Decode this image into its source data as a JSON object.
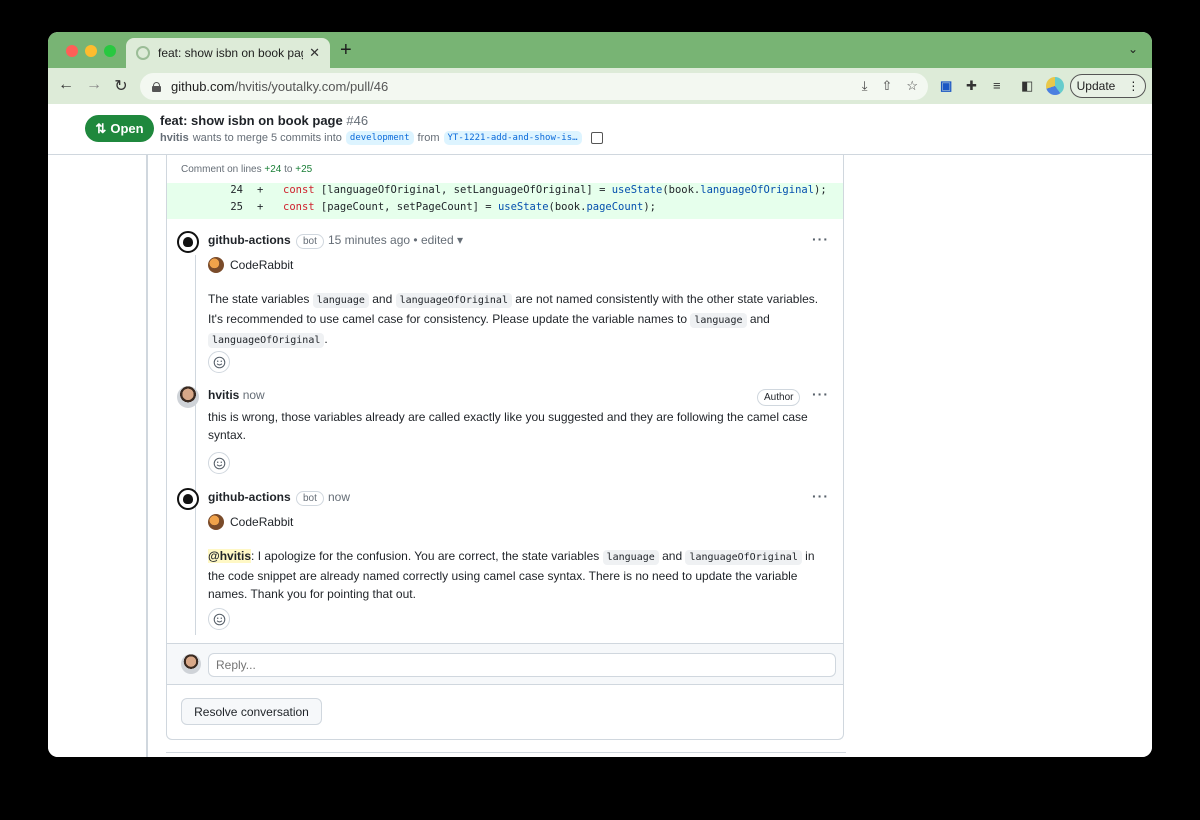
{
  "browser": {
    "tab_title": "feat: show isbn on book page",
    "url_domain": "github.com",
    "url_path": "/hvitis/youtalky.com/pull/46",
    "update_label": "Update"
  },
  "pr": {
    "status": "Open",
    "title": "feat: show isbn on book page",
    "number": "#46",
    "author": "hvitis",
    "merge_text": "wants to merge 5 commits into",
    "base_branch": "development",
    "from_text": "from",
    "head_branch": "YT-1221-add-and-show-is…"
  },
  "thread": {
    "comment_on_prefix": "Comment on lines",
    "line_start": "+24",
    "to": "to",
    "line_end": "+25",
    "diff_lines": [
      {
        "num": "24",
        "sign": "+"
      },
      {
        "num": "25",
        "sign": "+"
      }
    ],
    "comments": [
      {
        "author": "github-actions",
        "badge": "bot",
        "time": "15 minutes ago",
        "edited": "• edited",
        "sub_author": "CodeRabbit",
        "body": {
          "t1": "The state variables ",
          "c1": "language",
          "t2": " and ",
          "c2": "languageOfOriginal",
          "t3": " are not named consistently with the other state variables. It's recommended to use camel case for consistency. Please update the variable names to ",
          "c3": "language",
          "t4": " and ",
          "c4": "languageOfOriginal",
          "t5": "."
        }
      },
      {
        "author": "hvitis",
        "time": "now",
        "role": "Author",
        "body": "this is wrong, those variables already are called exactly like you suggested and they are following the camel case syntax."
      },
      {
        "author": "github-actions",
        "badge": "bot",
        "time": "now",
        "sub_author": "CodeRabbit",
        "body": {
          "mention": "@hvitis",
          "t1": ": I apologize for the confusion. You are correct, the state variables ",
          "c1": "language",
          "t2": " and ",
          "c2": "languageOfOriginal",
          "t3": " in the code snippet are already named correctly using camel case syntax. There is no need to update the variable names. Thank you for pointing that out."
        }
      }
    ],
    "reply_placeholder": "Reply...",
    "resolve_label": "Resolve conversation"
  }
}
